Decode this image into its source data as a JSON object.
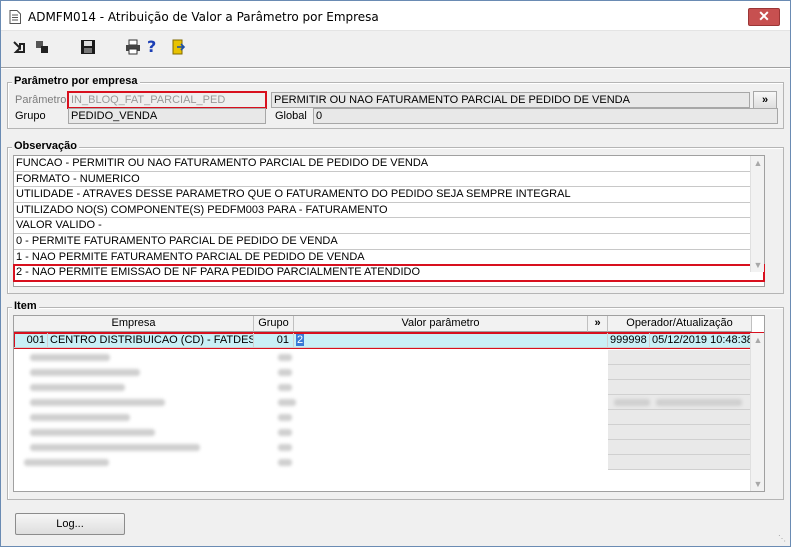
{
  "window": {
    "title": "ADMFM014 - Atribuição de Valor a Parâmetro por Empresa",
    "close_label": "✕"
  },
  "toolbar": {
    "icons": [
      "arrow-exit-icon",
      "tool-icon",
      "save-icon",
      "print-icon",
      "help-icon",
      "door-exit-icon"
    ],
    "help_glyph": "?"
  },
  "parametro": {
    "group_title": "Parâmetro por empresa",
    "param_label": "Parâmetro",
    "param_value": "IN_BLOQ_FAT_PARCIAL_PED",
    "param_desc": "PERMITIR OU NAO FATURAMENTO PARCIAL DE PEDIDO DE VENDA",
    "more_label": "»",
    "grupo_label": "Grupo",
    "grupo_value": "PEDIDO_VENDA",
    "global_label": "Global",
    "global_value": "0"
  },
  "observacao": {
    "group_title": "Observação",
    "lines": [
      "FUNCAO - PERMITIR OU NAO FATURAMENTO PARCIAL DE PEDIDO DE VENDA",
      "FORMATO - NUMERICO",
      "UTILIDADE - ATRAVES DESSE PARAMETRO QUE O FATURAMENTO DO PEDIDO SEJA SEMPRE INTEGRAL",
      "UTILIZADO NO(S) COMPONENTE(S) PEDFM003  PARA  - FATURAMENTO",
      "VALOR VALIDO -",
      "0 - PERMITE FATURAMENTO PARCIAL DE PEDIDO DE VENDA",
      "1 - NAO PERMITE FATURAMENTO PARCIAL DE PEDIDO DE VENDA",
      "2 - NAO PERMITE EMISSAO DE NF PARA PEDIDO PARCIALMENTE ATENDIDO"
    ]
  },
  "item": {
    "group_title": "Item",
    "columns": {
      "empresa": "Empresa",
      "grupo": "Grupo",
      "valor": "Valor parâmetro",
      "more": "»",
      "operador": "Operador/Atualização"
    },
    "first_row": {
      "code": "001",
      "empresa": "CENTRO DISTRIBUICAO (CD) - FATDES",
      "grupo": "01",
      "valor": "2",
      "operador": "999998",
      "data": "05/12/2019 10:48:38"
    }
  },
  "footer": {
    "log_label": "Log..."
  }
}
